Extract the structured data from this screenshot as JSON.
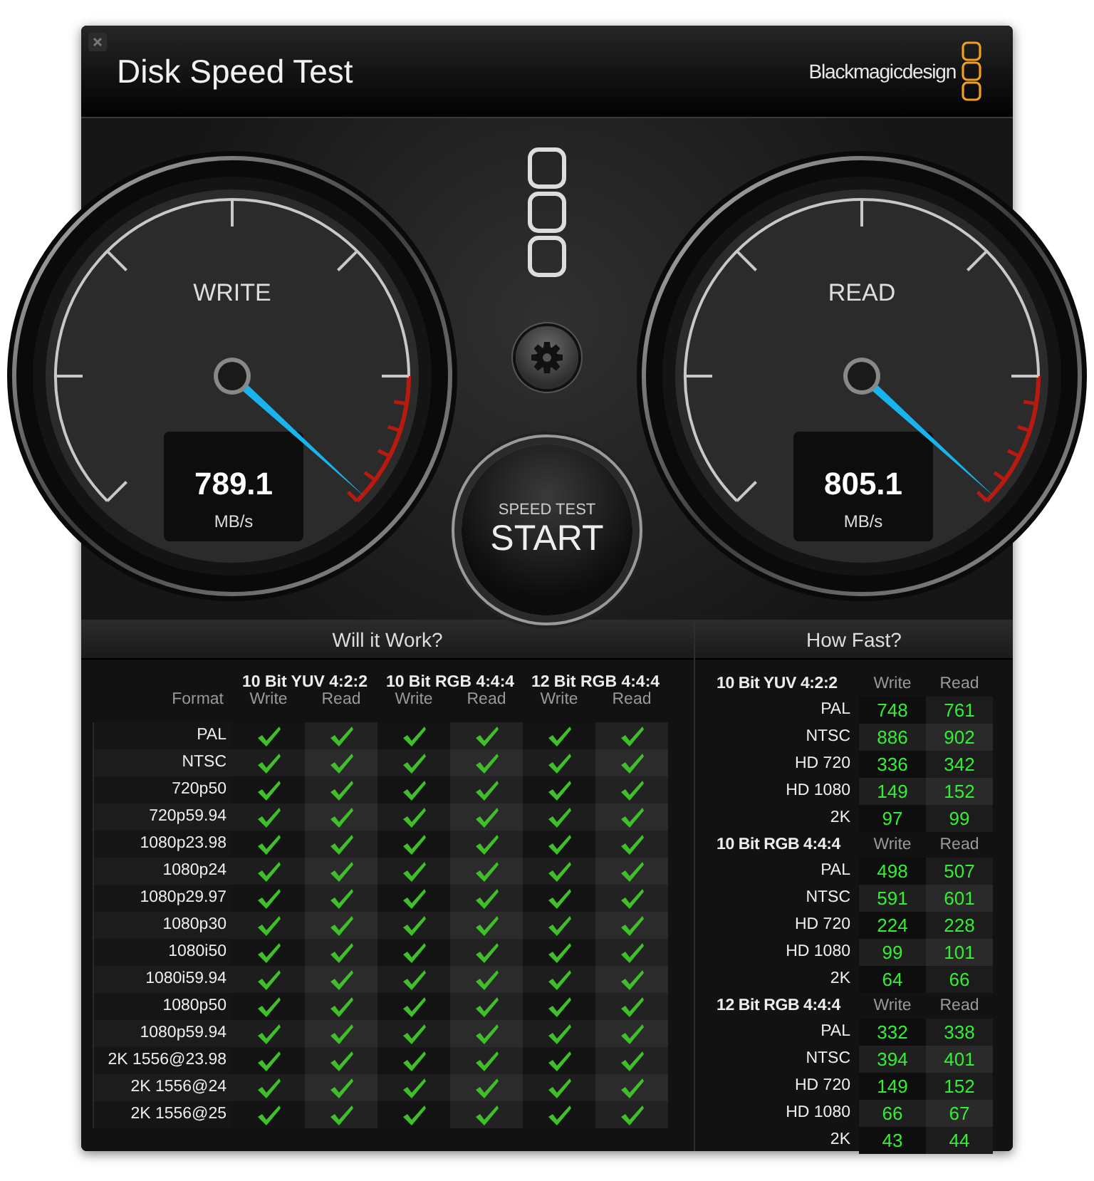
{
  "window": {
    "title": "Disk Speed Test",
    "brand": "Blackmagicdesign"
  },
  "gauges": [
    {
      "label": "WRITE",
      "value": "789.1",
      "unit": "MB/s",
      "level": 0.99
    },
    {
      "label": "READ",
      "value": "805.1",
      "unit": "MB/s",
      "level": 0.99
    }
  ],
  "start_button": {
    "caption": "SPEED TEST",
    "label": "START"
  },
  "will_it_work": {
    "title": "Will it Work?",
    "format_heading": "Format",
    "groups": [
      {
        "name": "10 Bit YUV 4:2:2",
        "columns": [
          "Write",
          "Read"
        ]
      },
      {
        "name": "10 Bit RGB 4:4:4",
        "columns": [
          "Write",
          "Read"
        ]
      },
      {
        "name": "12 Bit RGB 4:4:4",
        "columns": [
          "Write",
          "Read"
        ]
      }
    ],
    "rows": [
      {
        "format": "PAL",
        "checks": [
          true,
          true,
          true,
          true,
          true,
          true
        ]
      },
      {
        "format": "NTSC",
        "checks": [
          true,
          true,
          true,
          true,
          true,
          true
        ]
      },
      {
        "format": "720p50",
        "checks": [
          true,
          true,
          true,
          true,
          true,
          true
        ]
      },
      {
        "format": "720p59.94",
        "checks": [
          true,
          true,
          true,
          true,
          true,
          true
        ]
      },
      {
        "format": "1080p23.98",
        "checks": [
          true,
          true,
          true,
          true,
          true,
          true
        ]
      },
      {
        "format": "1080p24",
        "checks": [
          true,
          true,
          true,
          true,
          true,
          true
        ]
      },
      {
        "format": "1080p29.97",
        "checks": [
          true,
          true,
          true,
          true,
          true,
          true
        ]
      },
      {
        "format": "1080p30",
        "checks": [
          true,
          true,
          true,
          true,
          true,
          true
        ]
      },
      {
        "format": "1080i50",
        "checks": [
          true,
          true,
          true,
          true,
          true,
          true
        ]
      },
      {
        "format": "1080i59.94",
        "checks": [
          true,
          true,
          true,
          true,
          true,
          true
        ]
      },
      {
        "format": "1080p50",
        "checks": [
          true,
          true,
          true,
          true,
          true,
          true
        ]
      },
      {
        "format": "1080p59.94",
        "checks": [
          true,
          true,
          true,
          true,
          true,
          true
        ]
      },
      {
        "format": "2K 1556@23.98",
        "checks": [
          true,
          true,
          true,
          true,
          true,
          true
        ]
      },
      {
        "format": "2K 1556@24",
        "checks": [
          true,
          true,
          true,
          true,
          true,
          true
        ]
      },
      {
        "format": "2K 1556@25",
        "checks": [
          true,
          true,
          true,
          true,
          true,
          true
        ]
      }
    ]
  },
  "how_fast": {
    "title": "How Fast?",
    "groups": [
      {
        "name": "10 Bit YUV 4:2:2",
        "write_heading": "Write",
        "read_heading": "Read",
        "rows": [
          {
            "format": "PAL",
            "write": "748",
            "read": "761"
          },
          {
            "format": "NTSC",
            "write": "886",
            "read": "902"
          },
          {
            "format": "HD 720",
            "write": "336",
            "read": "342"
          },
          {
            "format": "HD 1080",
            "write": "149",
            "read": "152"
          },
          {
            "format": "2K",
            "write": "97",
            "read": "99"
          }
        ]
      },
      {
        "name": "10 Bit RGB 4:4:4",
        "write_heading": "Write",
        "read_heading": "Read",
        "rows": [
          {
            "format": "PAL",
            "write": "498",
            "read": "507"
          },
          {
            "format": "NTSC",
            "write": "591",
            "read": "601"
          },
          {
            "format": "HD 720",
            "write": "224",
            "read": "228"
          },
          {
            "format": "HD 1080",
            "write": "99",
            "read": "101"
          },
          {
            "format": "2K",
            "write": "64",
            "read": "66"
          }
        ]
      },
      {
        "name": "12 Bit RGB 4:4:4",
        "write_heading": "Write",
        "read_heading": "Read",
        "rows": [
          {
            "format": "PAL",
            "write": "332",
            "read": "338"
          },
          {
            "format": "NTSC",
            "write": "394",
            "read": "401"
          },
          {
            "format": "HD 720",
            "write": "149",
            "read": "152"
          },
          {
            "format": "HD 1080",
            "write": "66",
            "read": "67"
          },
          {
            "format": "2K",
            "write": "43",
            "read": "44"
          }
        ]
      }
    ]
  }
}
